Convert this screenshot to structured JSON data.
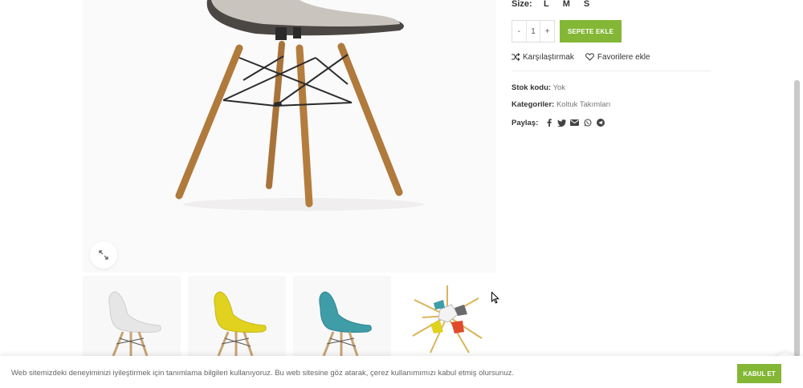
{
  "product": {
    "size_label": "Size:",
    "sizes": [
      "L",
      "M",
      "S"
    ],
    "quantity": "1",
    "qty_minus": "-",
    "qty_plus": "+",
    "add_to_cart": "SEPETE EKLE",
    "compare_label": "Karşılaştırmak",
    "wishlist_label": "Favorilere ekle",
    "sku_label": "Stok kodu:",
    "sku_value": "Yok",
    "category_label": "Kategoriler:",
    "category_value": "Koltuk Takımları",
    "share_label": "Paylaş:",
    "share_icons": [
      "facebook-icon",
      "twitter-icon",
      "email-icon",
      "whatsapp-icon",
      "telegram-icon"
    ]
  },
  "gallery": {
    "thumbnails": [
      {
        "name": "white-chair",
        "color": "#ececec"
      },
      {
        "name": "yellow-chair",
        "color": "#e0d21e"
      },
      {
        "name": "teal-chair",
        "color": "#3f9da8"
      },
      {
        "name": "chairs-collage",
        "color": "#e9c24a"
      }
    ]
  },
  "cookie": {
    "message": "Web sitemizdeki deneyiminizi iyileştirmek için tanımlama bilgileri kullanıyoruz. Bu web sitesine göz atarak, çerez kullanımımızı kabul etmiş olursunuz.",
    "accept_label": "KABUL ET"
  },
  "colors": {
    "accent": "#83b735"
  }
}
